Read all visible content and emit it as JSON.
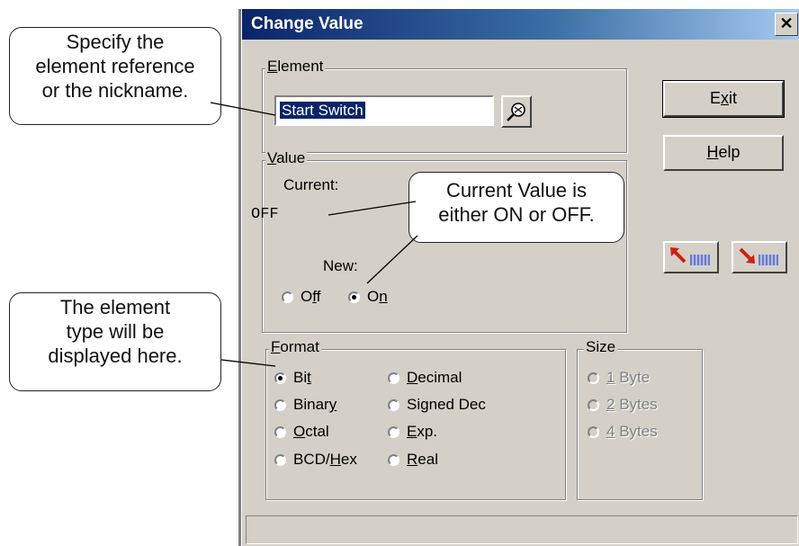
{
  "callouts": {
    "element_ref": [
      "Specify the",
      "element reference",
      "or the nickname."
    ],
    "element_type": [
      "The element",
      "type will be",
      "displayed here."
    ],
    "current_value": [
      "Current Value is",
      "either ON or OFF."
    ]
  },
  "dialog": {
    "title": "Change Value",
    "close_glyph": "✕",
    "element_group": {
      "label_pre": "",
      "label_key": "E",
      "label_post": "lement",
      "value": "Start Switch"
    },
    "value_group": {
      "label_key": "V",
      "label_post": "alue",
      "current_label": "Current:",
      "current_value": "OFF",
      "new_label": "New:",
      "off": {
        "pre": "O",
        "key": "f",
        "post": "f",
        "selected": false
      },
      "on": {
        "pre": "O",
        "key": "n",
        "post": "",
        "selected": true
      }
    },
    "buttons": {
      "exit": {
        "pre": "E",
        "key": "x",
        "post": "it"
      },
      "help": {
        "pre": "",
        "key": "H",
        "post": "elp"
      }
    },
    "format_group": {
      "label_key": "F",
      "label_post": "ormat",
      "options": [
        {
          "pre": "Bi",
          "key": "t",
          "post": "",
          "selected": true
        },
        {
          "pre": "Binar",
          "key": "y",
          "post": "",
          "selected": false
        },
        {
          "pre": "",
          "key": "O",
          "post": "ctal",
          "selected": false
        },
        {
          "pre": "BCD/",
          "key": "H",
          "post": "ex",
          "selected": false
        },
        {
          "pre": "",
          "key": "D",
          "post": "ecimal",
          "selected": false
        },
        {
          "pre": "Signed Dec",
          "key": "",
          "post": "",
          "selected": false
        },
        {
          "pre": "",
          "key": "E",
          "post": "xp.",
          "selected": false
        },
        {
          "pre": "",
          "key": "R",
          "post": "eal",
          "selected": false
        }
      ]
    },
    "size_group": {
      "label": "Size",
      "options": [
        {
          "key": "1",
          "post": " Byte"
        },
        {
          "key": "2",
          "post": " Bytes"
        },
        {
          "key": "4",
          "post": " Bytes"
        }
      ]
    },
    "colors": {
      "title_start": "#0a246a",
      "title_end": "#a6caf0",
      "face": "#d4d0c8",
      "selection": "#0a246a"
    }
  }
}
